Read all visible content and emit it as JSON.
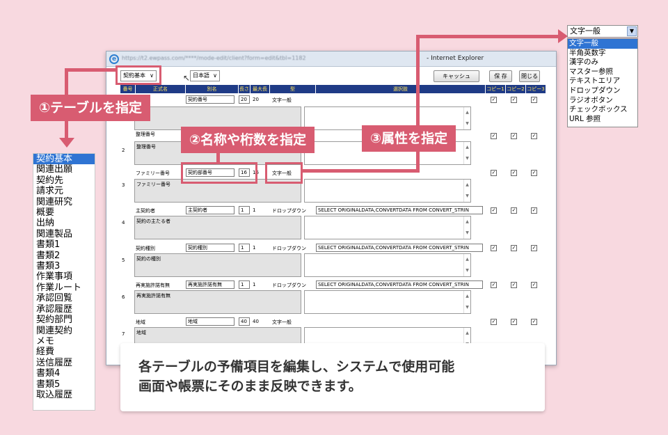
{
  "window": {
    "url": "https://t2.ewpass.com/****/mode-edit/client?form=edit&tbl=1182",
    "title": "- Internet Explorer"
  },
  "toolbar": {
    "table_select": "契約基本",
    "language_select": "日本語",
    "cancel_label": "キャッシュ",
    "save_label": "保 存",
    "close_label": "閉じる"
  },
  "grid": {
    "headers": [
      "番号",
      "正式名",
      "別名",
      "長さ",
      "最大長",
      "型",
      "選択肢",
      "コピー1",
      "コピー2",
      "コピー3"
    ],
    "rows": [
      {
        "num": "",
        "name": "",
        "alias": "契約番号",
        "len": "20",
        "max": "20",
        "type": "文字一般",
        "choice": "",
        "desc": ""
      },
      {
        "num": "2",
        "name": "整理番号",
        "alias": "",
        "len": "",
        "max": "",
        "type": "",
        "choice": "",
        "desc": "整理番号"
      },
      {
        "num": "3",
        "name": "ファミリー番号",
        "alias": "契約部番号",
        "len": "16",
        "max": "16",
        "type": "文字一般",
        "choice": "",
        "desc": "ファミリー番号"
      },
      {
        "num": "4",
        "name": "主契約者",
        "alias": "主契約者",
        "len": "1",
        "max": "1",
        "type": "ドロップダウン",
        "choice": "SELECT ORIGINALDATA,CONVERTDATA FROM CONVERT_STRIN",
        "desc": "契約の主たる者"
      },
      {
        "num": "5",
        "name": "契約種別",
        "alias": "契約種別",
        "len": "1",
        "max": "1",
        "type": "ドロップダウン",
        "choice": "SELECT ORIGINALDATA,CONVERTDATA FROM CONVERT_STRIN",
        "desc": "契約の種別"
      },
      {
        "num": "6",
        "name": "再実施許諾有無",
        "alias": "再実施許諾有無",
        "len": "1",
        "max": "1",
        "type": "ドロップダウン",
        "choice": "SELECT ORIGINALDATA,CONVERTDATA FROM CONVERT_STRIN",
        "desc": "再実施許諾有無"
      },
      {
        "num": "7",
        "name": "地域",
        "alias": "地域",
        "len": "40",
        "max": "40",
        "type": "文字一般",
        "choice": "",
        "desc": "地域"
      }
    ],
    "check": "✓"
  },
  "callouts": {
    "c1": "①テーブルを指定",
    "c2": "②名称や桁数を指定",
    "c3": "③属性を指定"
  },
  "table_list": [
    "契約基本",
    "関連出願",
    "契約先",
    "請求元",
    "関連研究",
    "概要",
    "出納",
    "関連製品",
    "書類1",
    "書類2",
    "書類3",
    "作業事項",
    "作業ルート",
    "承認回覧",
    "承認履歴",
    "契約部門",
    "関連契約",
    "メモ",
    "経費",
    "送信履歴",
    "書類4",
    "書類5",
    "取込履歴"
  ],
  "attr_select": {
    "value": "文字一般",
    "options": [
      "文字一般",
      "半角英数字",
      "漢字のみ",
      "マスター参照",
      "テキストエリア",
      "ドロップダウン",
      "ラジオボタン",
      "チェックボックス",
      "URL 参照"
    ]
  },
  "caption": {
    "line1": "各テーブルの予備項目を編集し、システムで使用可能",
    "line2": "画面や帳票にそのまま反映できます。"
  }
}
